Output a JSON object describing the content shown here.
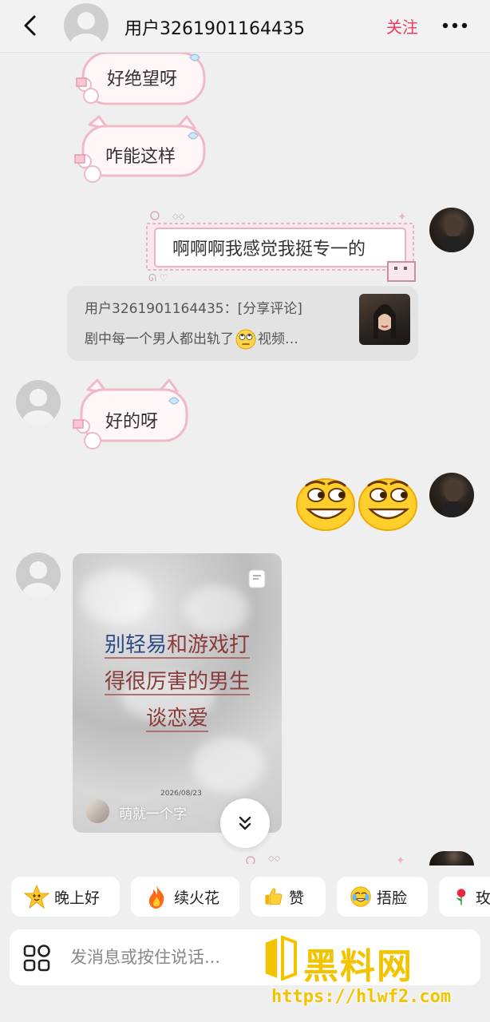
{
  "header": {
    "title": "用户3261901164435",
    "follow_label": "关注"
  },
  "messages": {
    "bubble_1": "好绝望呀",
    "bubble_2": "咋能这样",
    "bubble_mine": "啊啊啊我感觉我挺专一的",
    "share_line1": "用户3261901164435：[分享评论]",
    "share_line2_a": "剧中每一个男人都出轨了",
    "share_line2_b": "视频…",
    "bubble_3": "好的呀",
    "video": {
      "title_blue": "别轻易",
      "title_rest1": "和游戏打",
      "title_line2": "得很厉害的男生",
      "title_line3": "谈恋爱",
      "date": "2026/08/23",
      "author": "萌就一个字"
    }
  },
  "quick_replies": [
    {
      "label": "晚上好",
      "icon": "star-face-icon"
    },
    {
      "label": "续火花",
      "icon": "fire-icon"
    },
    {
      "label": "赞",
      "icon": "thumbs-up-icon"
    },
    {
      "label": "捂脸",
      "icon": "facepalm-icon"
    },
    {
      "label": "玫",
      "icon": "rose-icon"
    }
  ],
  "input": {
    "placeholder": "发消息或按住说话..."
  },
  "watermark": {
    "text": "黑料网",
    "url": "https://hlwf2.com"
  },
  "colors": {
    "accent": "#ef3b5a",
    "background": "#efefef",
    "watermark": "#f4c300"
  }
}
